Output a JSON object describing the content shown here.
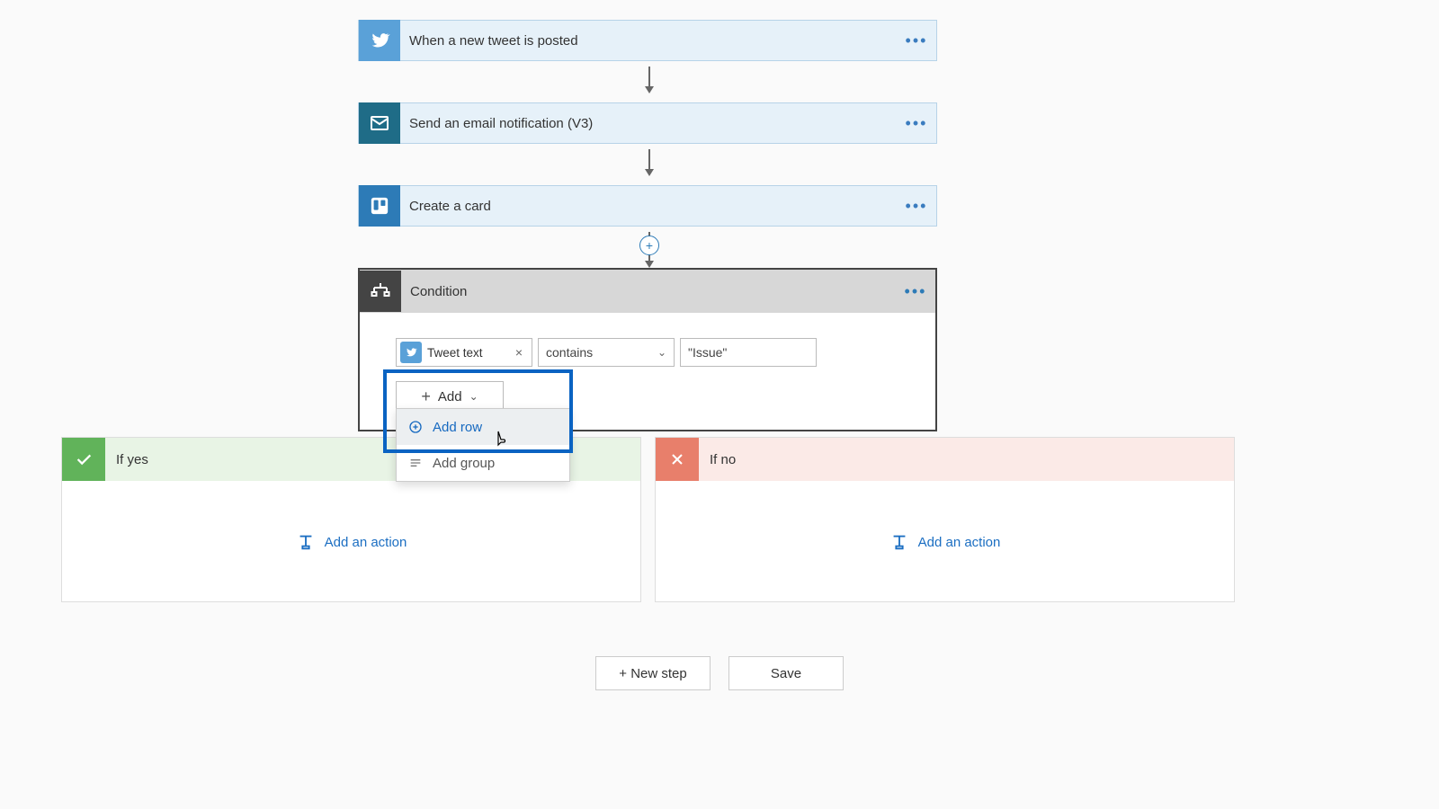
{
  "steps": [
    {
      "label": "When a new tweet is posted"
    },
    {
      "label": "Send an email notification (V3)"
    },
    {
      "label": "Create a card"
    }
  ],
  "condition": {
    "title": "Condition",
    "left_token": "Tweet text",
    "operator": "contains",
    "right_value": "\"Issue\"",
    "add_label": "Add",
    "menu": {
      "row": "Add row",
      "group": "Add group"
    }
  },
  "branches": {
    "yes": "If yes",
    "no": "If no",
    "add_action": "Add an action"
  },
  "footer": {
    "new_step": "+ New step",
    "save": "Save"
  }
}
